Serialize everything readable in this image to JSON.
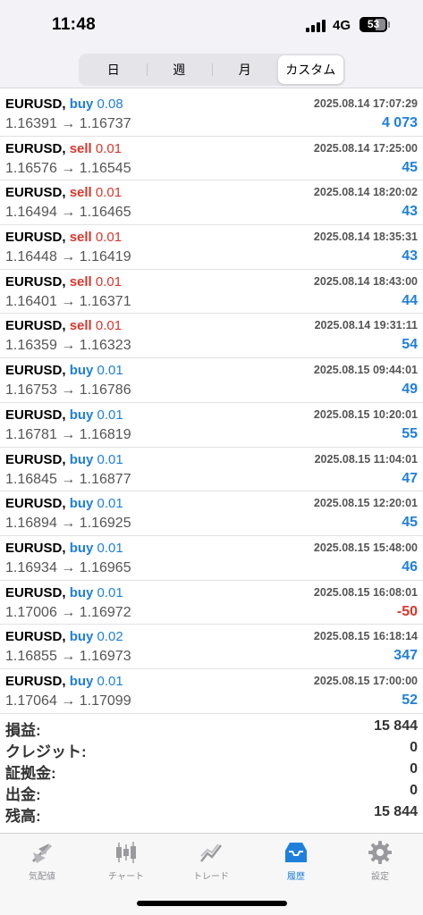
{
  "status_bar": {
    "time": "11:48",
    "network": "4G",
    "battery": "53"
  },
  "segmented": {
    "tabs": [
      "日",
      "週",
      "月",
      "カスタム"
    ],
    "active": 3
  },
  "trades": [
    {
      "symbol": "EURUSD,",
      "side": "buy",
      "lot": "0.08",
      "datetime": "2025.08.14 17:07:29",
      "open": "1.16391",
      "close": "1.16737",
      "profit": "4 073"
    },
    {
      "symbol": "EURUSD,",
      "side": "sell",
      "lot": "0.01",
      "datetime": "2025.08.14 17:25:00",
      "open": "1.16576",
      "close": "1.16545",
      "profit": "45"
    },
    {
      "symbol": "EURUSD,",
      "side": "sell",
      "lot": "0.01",
      "datetime": "2025.08.14 18:20:02",
      "open": "1.16494",
      "close": "1.16465",
      "profit": "43"
    },
    {
      "symbol": "EURUSD,",
      "side": "sell",
      "lot": "0.01",
      "datetime": "2025.08.14 18:35:31",
      "open": "1.16448",
      "close": "1.16419",
      "profit": "43"
    },
    {
      "symbol": "EURUSD,",
      "side": "sell",
      "lot": "0.01",
      "datetime": "2025.08.14 18:43:00",
      "open": "1.16401",
      "close": "1.16371",
      "profit": "44"
    },
    {
      "symbol": "EURUSD,",
      "side": "sell",
      "lot": "0.01",
      "datetime": "2025.08.14 19:31:11",
      "open": "1.16359",
      "close": "1.16323",
      "profit": "54"
    },
    {
      "symbol": "EURUSD,",
      "side": "buy",
      "lot": "0.01",
      "datetime": "2025.08.15 09:44:01",
      "open": "1.16753",
      "close": "1.16786",
      "profit": "49"
    },
    {
      "symbol": "EURUSD,",
      "side": "buy",
      "lot": "0.01",
      "datetime": "2025.08.15 10:20:01",
      "open": "1.16781",
      "close": "1.16819",
      "profit": "55"
    },
    {
      "symbol": "EURUSD,",
      "side": "buy",
      "lot": "0.01",
      "datetime": "2025.08.15 11:04:01",
      "open": "1.16845",
      "close": "1.16877",
      "profit": "47"
    },
    {
      "symbol": "EURUSD,",
      "side": "buy",
      "lot": "0.01",
      "datetime": "2025.08.15 12:20:01",
      "open": "1.16894",
      "close": "1.16925",
      "profit": "45"
    },
    {
      "symbol": "EURUSD,",
      "side": "buy",
      "lot": "0.01",
      "datetime": "2025.08.15 15:48:00",
      "open": "1.16934",
      "close": "1.16965",
      "profit": "46"
    },
    {
      "symbol": "EURUSD,",
      "side": "buy",
      "lot": "0.01",
      "datetime": "2025.08.15 16:08:01",
      "open": "1.17006",
      "close": "1.16972",
      "profit": "-50"
    },
    {
      "symbol": "EURUSD,",
      "side": "buy",
      "lot": "0.02",
      "datetime": "2025.08.15 16:18:14",
      "open": "1.16855",
      "close": "1.16973",
      "profit": "347"
    },
    {
      "symbol": "EURUSD,",
      "side": "buy",
      "lot": "0.01",
      "datetime": "2025.08.15 17:00:00",
      "open": "1.17064",
      "close": "1.17099",
      "profit": "52"
    }
  ],
  "arrow": "→",
  "summary": [
    {
      "label": "損益:",
      "value": "15 844"
    },
    {
      "label": "クレジット:",
      "value": "0"
    },
    {
      "label": "証拠金:",
      "value": "0"
    },
    {
      "label": "出金:",
      "value": "0"
    },
    {
      "label": "残高:",
      "value": "15 844"
    }
  ],
  "tab_bar": {
    "items": [
      {
        "label": "気配値",
        "icon": "quotes-icon"
      },
      {
        "label": "チャート",
        "icon": "chart-icon"
      },
      {
        "label": "トレード",
        "icon": "trade-icon"
      },
      {
        "label": "履歴",
        "icon": "history-icon"
      },
      {
        "label": "設定",
        "icon": "settings-icon"
      }
    ],
    "active": 3
  },
  "colors": {
    "buy": "#1f7fdc",
    "sell": "#d8372c",
    "active_tab": "#1f7fdc",
    "inactive_tab": "#8e8e93"
  }
}
